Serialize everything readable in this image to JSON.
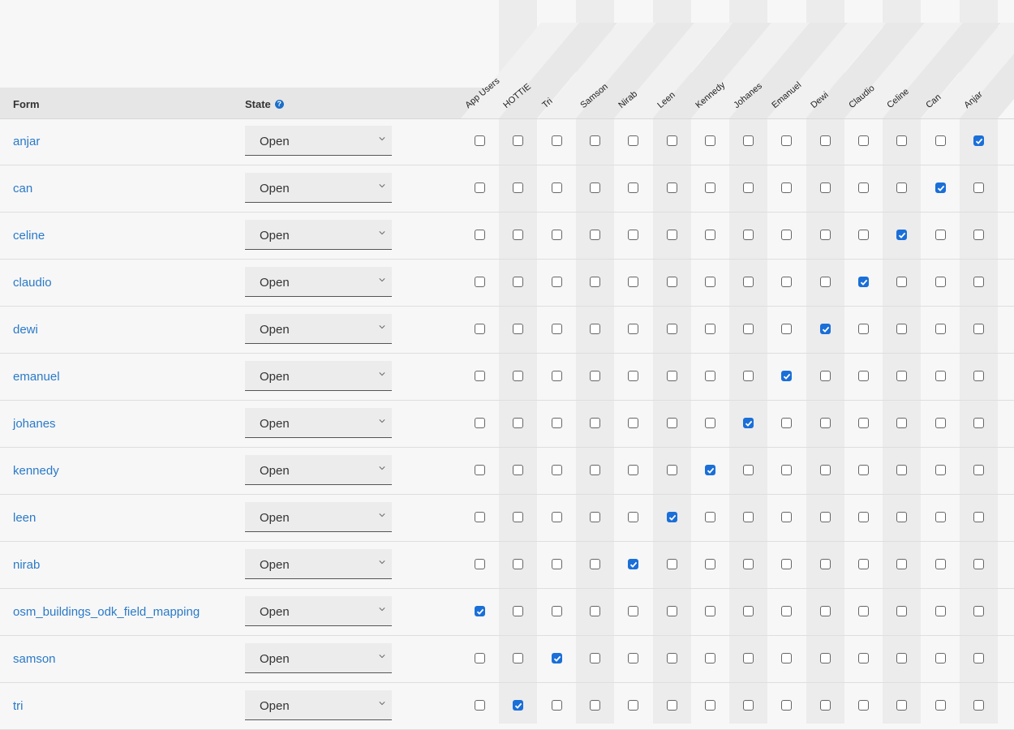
{
  "headers": {
    "form": "Form",
    "state": "State",
    "help_icon": "?",
    "users": [
      "App Users",
      "HOTTIE",
      "Tri",
      "Samson",
      "Nirab",
      "Leen",
      "Kennedy",
      "Johanes",
      "Emanuel",
      "Dewi",
      "Claudio",
      "Celine",
      "Can",
      "Anjar"
    ]
  },
  "colors": {
    "link": "#2a7ac8",
    "checked": "#1a6fd8",
    "band": "#ececec"
  },
  "rows": [
    {
      "form": "anjar",
      "state": "Open",
      "checked_index": 13
    },
    {
      "form": "can",
      "state": "Open",
      "checked_index": 12
    },
    {
      "form": "celine",
      "state": "Open",
      "checked_index": 11
    },
    {
      "form": "claudio",
      "state": "Open",
      "checked_index": 10
    },
    {
      "form": "dewi",
      "state": "Open",
      "checked_index": 9
    },
    {
      "form": "emanuel",
      "state": "Open",
      "checked_index": 8
    },
    {
      "form": "johanes",
      "state": "Open",
      "checked_index": 7
    },
    {
      "form": "kennedy",
      "state": "Open",
      "checked_index": 6
    },
    {
      "form": "leen",
      "state": "Open",
      "checked_index": 5
    },
    {
      "form": "nirab",
      "state": "Open",
      "checked_index": 4
    },
    {
      "form": "osm_buildings_odk_field_mapping",
      "state": "Open",
      "checked_index": 0
    },
    {
      "form": "samson",
      "state": "Open",
      "checked_index": 2
    },
    {
      "form": "tri",
      "state": "Open",
      "checked_index": 1
    }
  ]
}
